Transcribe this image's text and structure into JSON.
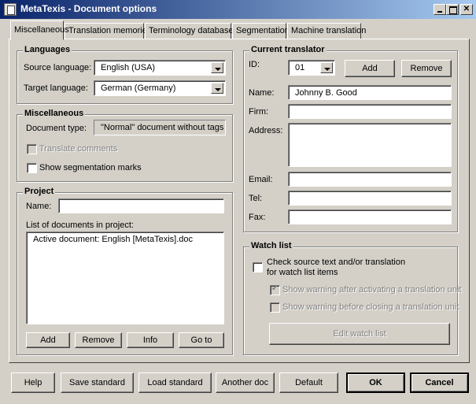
{
  "window": {
    "title": "MetaTexis - Document options"
  },
  "tabs": [
    "Miscellaneous",
    "Translation memories",
    "Terminology databases",
    "Segmentation",
    "Machine translation"
  ],
  "languages": {
    "heading": "Languages",
    "source_label": "Source language:",
    "source_value": "English (USA)",
    "target_label": "Target language:",
    "target_value": "German (Germany)"
  },
  "misc": {
    "heading": "Miscellaneous",
    "doc_type_label": "Document type:",
    "doc_type_value": "\"Normal\" document without tags",
    "translate_comments": "Translate comments",
    "show_segmentation": "Show segmentation marks"
  },
  "project": {
    "heading": "Project",
    "name_label": "Name:",
    "name_value": "",
    "list_label": "List of documents in project:",
    "documents": [
      "Active document: English [MetaTexis].doc"
    ],
    "buttons": {
      "add": "Add",
      "remove": "Remove",
      "info": "Info",
      "goto": "Go to"
    }
  },
  "translator": {
    "heading": "Current translator",
    "id_label": "ID:",
    "id_value": "01",
    "add": "Add",
    "remove": "Remove",
    "name_label": "Name:",
    "name_value": "Johnny B. Good",
    "firm_label": "Firm:",
    "firm_value": "",
    "address_label": "Address:",
    "address_value": "",
    "email_label": "Email:",
    "email_value": "",
    "tel_label": "Tel:",
    "tel_value": "",
    "fax_label": "Fax:",
    "fax_value": ""
  },
  "watch": {
    "heading": "Watch list",
    "check_line1": "Check source text and/or translation",
    "check_line2": "for watch list items",
    "warn_after": "Show warning after activating a translation unit",
    "warn_before": "Show warning before closing a translation unit",
    "edit": "Edit watch list"
  },
  "footer": {
    "help": "Help",
    "save_standard": "Save standard",
    "load_standard": "Load standard",
    "another_doc": "Another doc",
    "default": "Default",
    "ok": "OK",
    "cancel": "Cancel"
  }
}
